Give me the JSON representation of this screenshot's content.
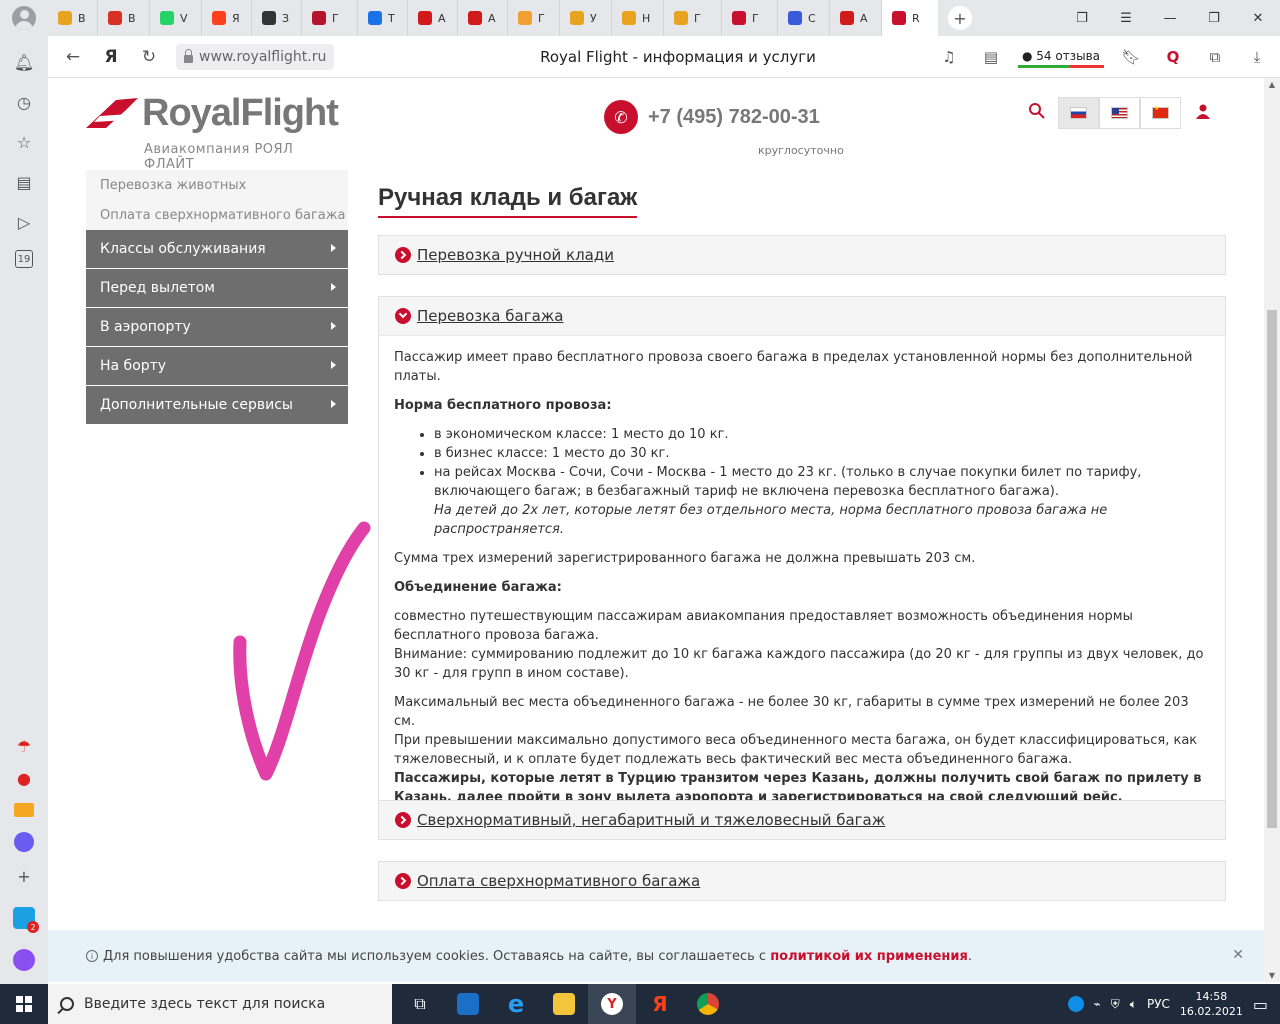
{
  "browser": {
    "tabs": [
      {
        "label": "В",
        "color": "#e8a320"
      },
      {
        "label": "В",
        "color": "#d93025"
      },
      {
        "label": "V",
        "color": "#25d366"
      },
      {
        "label": "Я",
        "color": "#fc3f1d"
      },
      {
        "label": "З",
        "color": "#333333"
      },
      {
        "label": "Г",
        "color": "#b3152d"
      },
      {
        "label": "Т",
        "color": "#1a73e8"
      },
      {
        "label": "А",
        "color": "#d11a1a"
      },
      {
        "label": "А",
        "color": "#d11a1a"
      },
      {
        "label": "Г",
        "color": "#f0a030"
      },
      {
        "label": "У",
        "color": "#e8a320"
      },
      {
        "label": "Н",
        "color": "#e8a320"
      },
      {
        "label": "Г",
        "color": "#e8a320"
      },
      {
        "label": "Г",
        "color": "#c8102e"
      },
      {
        "label": "С",
        "color": "#3a5bd9"
      },
      {
        "label": "А",
        "color": "#d11a1a"
      },
      {
        "label": "R",
        "color": "#c8102e"
      }
    ],
    "url": "www.royalflight.ru",
    "page_title": "Royal Flight - информация и услуги",
    "reviews": "54 отзыва",
    "sidebar_badge": "19"
  },
  "header": {
    "logo_name": "RoyalFlight",
    "logo_sub": "Авиакомпания РОЯЛ ФЛАЙТ",
    "phone": "+7 (495) 782-00-31",
    "hours": "круглосуточно"
  },
  "menu": {
    "light_items": [
      "Перевозка животных",
      "Оплата сверхнормативного багажа"
    ],
    "dark_items": [
      "Классы обслуживания",
      "Перед вылетом",
      "В аэропорту",
      "На борту",
      "Дополнительные сервисы"
    ]
  },
  "content": {
    "title": "Ручная кладь и багаж",
    "sections": [
      "Перевозка ручной клади",
      "Перевозка багажа",
      "Сверхнормативный, негабаритный и тяжеловесный багаж",
      "Оплата сверхнормативного багажа"
    ],
    "body": {
      "intro": "Пассажир имеет право бесплатного провоза своего багажа в пределах установленной нормы без дополнительной платы.",
      "norm_title": "Норма бесплатного провоза:",
      "norms": [
        "в экономическом классе: 1 место до 10 кг.",
        "в бизнес классе: 1 место до 30 кг.",
        "на рейсах Москва - Сочи, Сочи - Москва - 1 место до 23 кг. (только в случае покупки билет по тарифу, включающего багаж; в безбагажный тариф не включена перевозка бесплатного багажа)."
      ],
      "children_note": "На детей до 2х лет, которые летят без отдельного места, норма бесплатного провоза багажа не распространяется.",
      "sum_note": "Сумма трех измерений зарегистрированного багажа не должна превышать 203 см.",
      "union_title": "Объединение багажа:",
      "union_p1": "совместно путешествующим пассажирам авиакомпания предоставляет возможность объединения нормы бесплатного провоза багажа.",
      "union_p2": "Внимание: суммированию подлежит до 10 кг багажа каждого пассажира (до 20 кг - для группы из двух человек, до 30 кг - для групп в ином составе).",
      "max_p1": "Максимальный вес места объединенного багажа - не более 30 кг, габариты в сумме трех измерений не более 203 см.",
      "max_p2": "При превышении максимально допустимого веса объединенного места багажа, он будет классифицироваться, как тяжеловесный, и к оплате будет подлежать весь фактический вес места объединенного багажа.",
      "turkey_note": "Пассажиры, которые летят в Турцию транзитом через Казань, должны получить свой багаж по прилету в Казань, далее пройти в зону вылета аэропорта и зарегистрироваться на свой следующий рейс."
    }
  },
  "cookie": {
    "text": "Для повышения удобства сайта мы используем cookies. Оставаясь на сайте, вы соглашаетесь с",
    "link": "политикой их применения",
    "end": "."
  },
  "taskbar": {
    "search_placeholder": "Введите здесь текст для поиска",
    "lang": "РУС",
    "time": "14:58",
    "date": "16.02.2021",
    "notification_count": "2"
  },
  "colors": {
    "brand": "#c8102e",
    "menu_dark": "#6e6e6e",
    "check": "#e040a8"
  }
}
